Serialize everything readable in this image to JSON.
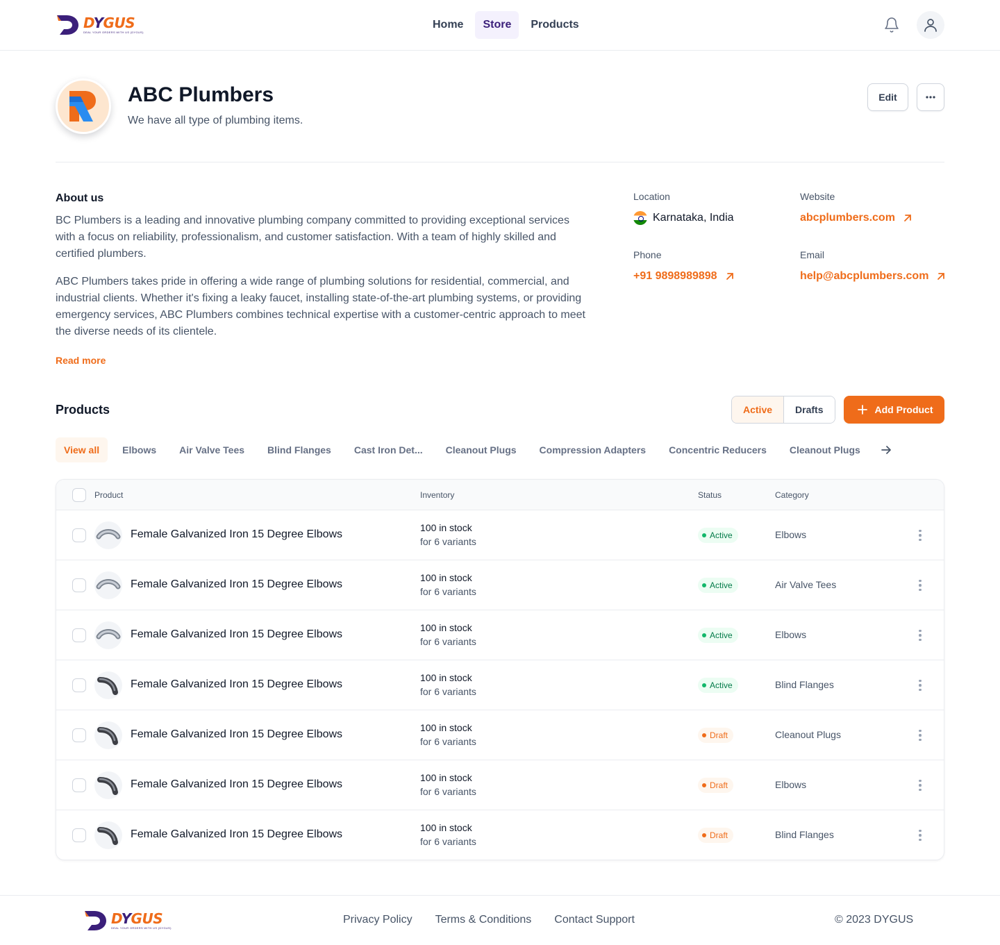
{
  "brand": {
    "name_part1": "D",
    "name_part2": "Y",
    "name_part3": "GUS",
    "tagline": "DEAL YOUR ORDERS WITH US (DYGUS)"
  },
  "nav": {
    "items": [
      "Home",
      "Store",
      "Products"
    ],
    "active": "Store"
  },
  "store": {
    "name": "ABC Plumbers",
    "tagline": "We have all type of plumbing items.",
    "edit_label": "Edit"
  },
  "about": {
    "title": "About us",
    "p1": "BC Plumbers is a leading and innovative plumbing company committed to providing exceptional services with a focus on reliability, professionalism, and customer satisfaction. With a team of highly skilled and certified plumbers.",
    "p2": "ABC Plumbers takes pride in offering a wide range of plumbing solutions for residential, commercial, and industrial clients. Whether it's fixing a leaky faucet, installing state-of-the-art plumbing systems, or providing emergency services, ABC Plumbers combines technical expertise with a customer-centric approach to meet the diverse needs of its clientele.",
    "read_more": "Read more"
  },
  "contact": {
    "location_label": "Location",
    "location": "Karnataka, India",
    "website_label": "Website",
    "website": "abcplumbers.com",
    "phone_label": "Phone",
    "phone": "+91 9898989898",
    "email_label": "Email",
    "email": "help@abcplumbers.com"
  },
  "products": {
    "title": "Products",
    "seg_active": "Active",
    "seg_drafts": "Drafts",
    "add_label": "Add Product",
    "filters": [
      "View all",
      "Elbows",
      "Air Valve Tees",
      "Blind Flanges",
      "Cast Iron Det...",
      "Cleanout Plugs",
      "Compression Adapters",
      "Concentric Reducers",
      "Cleanout Plugs"
    ],
    "columns": {
      "product": "Product",
      "inventory": "Inventory",
      "status": "Status",
      "category": "Category"
    },
    "rows": [
      {
        "name": "Female Galvanized Iron 15 Degree Elbows",
        "stock": "100 in stock",
        "variants": "for 6 variants",
        "status": "Active",
        "category": "Elbows"
      },
      {
        "name": "Female Galvanized Iron 15 Degree Elbows",
        "stock": "100 in stock",
        "variants": "for 6 variants",
        "status": "Active",
        "category": "Air Valve Tees"
      },
      {
        "name": "Female Galvanized Iron 15 Degree Elbows",
        "stock": "100 in stock",
        "variants": "for 6 variants",
        "status": "Active",
        "category": "Elbows"
      },
      {
        "name": "Female Galvanized Iron 15 Degree Elbows",
        "stock": "100 in stock",
        "variants": "for 6 variants",
        "status": "Active",
        "category": "Blind Flanges"
      },
      {
        "name": "Female Galvanized Iron 15 Degree Elbows",
        "stock": "100 in stock",
        "variants": "for 6 variants",
        "status": "Draft",
        "category": "Cleanout Plugs"
      },
      {
        "name": "Female Galvanized Iron 15 Degree Elbows",
        "stock": "100 in stock",
        "variants": "for 6 variants",
        "status": "Draft",
        "category": "Elbows"
      },
      {
        "name": "Female Galvanized Iron 15 Degree Elbows",
        "stock": "100 in stock",
        "variants": "for 6 variants",
        "status": "Draft",
        "category": "Blind Flanges"
      }
    ]
  },
  "footer": {
    "links": [
      "Privacy Policy",
      "Terms & Conditions",
      "Contact Support"
    ],
    "copyright": "© 2023 DYGUS"
  },
  "colors": {
    "accent": "#ef6c1a",
    "brand_purple": "#3b1f7a",
    "success": "#12b76a"
  },
  "icons": [
    "bell-icon",
    "user-icon",
    "more-horizontal-icon",
    "external-link-icon",
    "plus-icon",
    "arrow-right-icon",
    "more-vertical-icon"
  ]
}
